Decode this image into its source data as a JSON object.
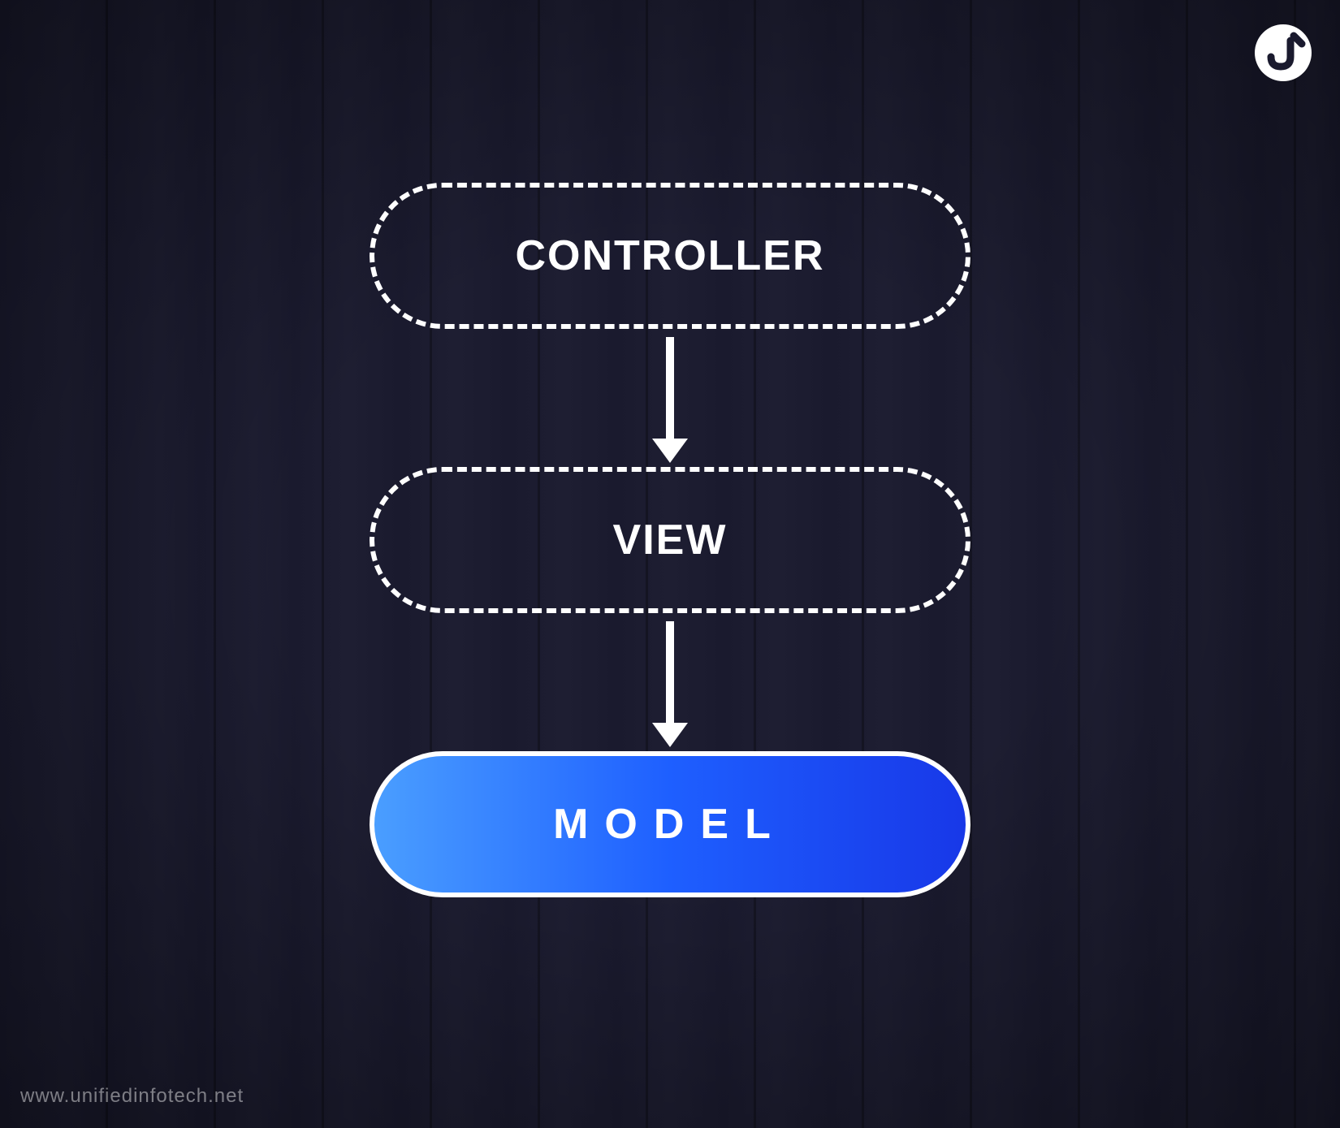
{
  "diagram": {
    "nodes": [
      {
        "id": "controller",
        "label": "CONTROLLER",
        "style": "dashed"
      },
      {
        "id": "view",
        "label": "VIEW",
        "style": "dashed"
      },
      {
        "id": "model",
        "label": "MODEL",
        "style": "solid-gradient"
      }
    ],
    "flow_direction": "top-to-bottom",
    "connectors": "arrow"
  },
  "footer": {
    "text": "www.unifiedinfotech.net"
  },
  "colors": {
    "background": "#1a1a2e",
    "node_border": "#ffffff",
    "node_text": "#ffffff",
    "gradient_start": "#4a9eff",
    "gradient_end": "#1838e8",
    "arrow": "#ffffff"
  }
}
